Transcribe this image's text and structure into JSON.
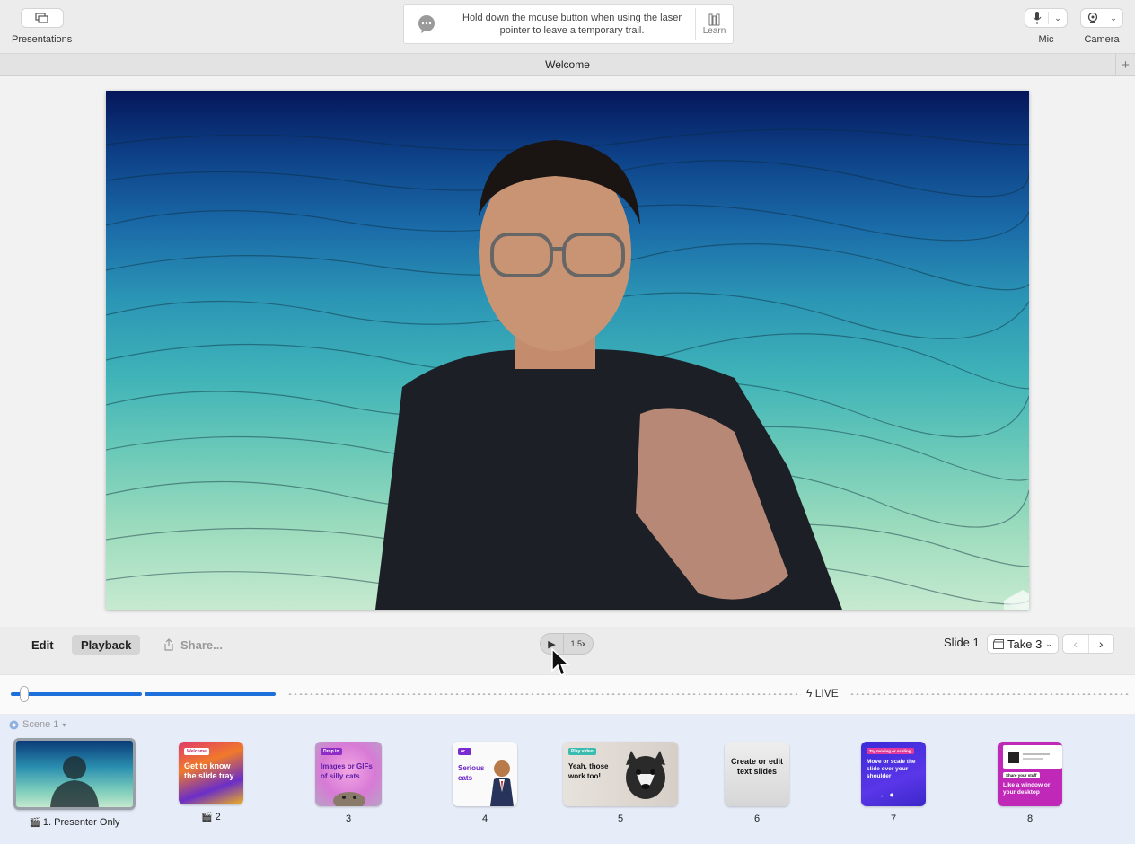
{
  "toolbar": {
    "presentations_label": "Presentations",
    "tip_text": "Hold down the mouse button when using the laser pointer to leave a temporary trail.",
    "learn_label": "Learn",
    "mic_label": "Mic",
    "camera_label": "Camera"
  },
  "tab": {
    "title": "Welcome",
    "add": "+"
  },
  "controls": {
    "edit": "Edit",
    "playback": "Playback",
    "share": "Share...",
    "play": "▶",
    "speed": "1.5x",
    "slide": "Slide 1",
    "take": "Take 3",
    "prev": "‹",
    "next": "›"
  },
  "timeline": {
    "live": "LIVE"
  },
  "tray": {
    "scene": "Scene 1",
    "slides": [
      {
        "caption": "1. Presenter Only"
      },
      {
        "caption": "2",
        "tag": "Welcome",
        "text": "Get to know the slide tray"
      },
      {
        "caption": "3",
        "tag": "Drop in",
        "text": "Images or GIFs of silly cats"
      },
      {
        "caption": "4",
        "tag": "or...",
        "text": "Serious cats"
      },
      {
        "caption": "5",
        "tag": "Play video",
        "text": "Yeah, those work too!"
      },
      {
        "caption": "6",
        "text": "Create or edit text slides"
      },
      {
        "caption": "7",
        "tag": "Try moving or scaling",
        "text": "Move or scale the slide over your shoulder"
      },
      {
        "caption": "8",
        "tag": "Share your stuff",
        "text": "Like a window or your desktop"
      }
    ]
  }
}
